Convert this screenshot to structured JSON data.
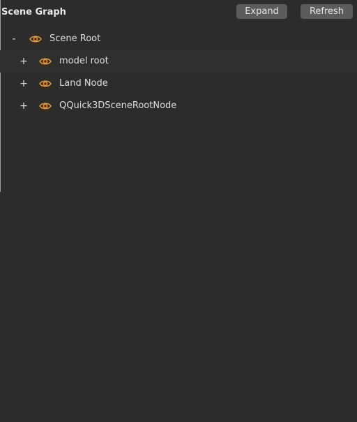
{
  "panel": {
    "title": "Scene Graph",
    "expand_label": "Expand",
    "refresh_label": "Refresh"
  },
  "tree": {
    "root": {
      "toggle": "-",
      "label": "Scene Root",
      "icon": "eye-icon"
    },
    "children": [
      {
        "toggle": "+",
        "label": "model root",
        "icon": "eye-icon"
      },
      {
        "toggle": "+",
        "label": "Land Node",
        "icon": "eye-icon"
      },
      {
        "toggle": "+",
        "label": "QQuick3DSceneRootNode",
        "icon": "eye-icon"
      }
    ]
  },
  "colors": {
    "background": "#2c2c2c",
    "row_alt": "#2f2f2f",
    "button": "#5c5c5c",
    "accent_eye": "#f0962a",
    "text": "#dedede"
  }
}
